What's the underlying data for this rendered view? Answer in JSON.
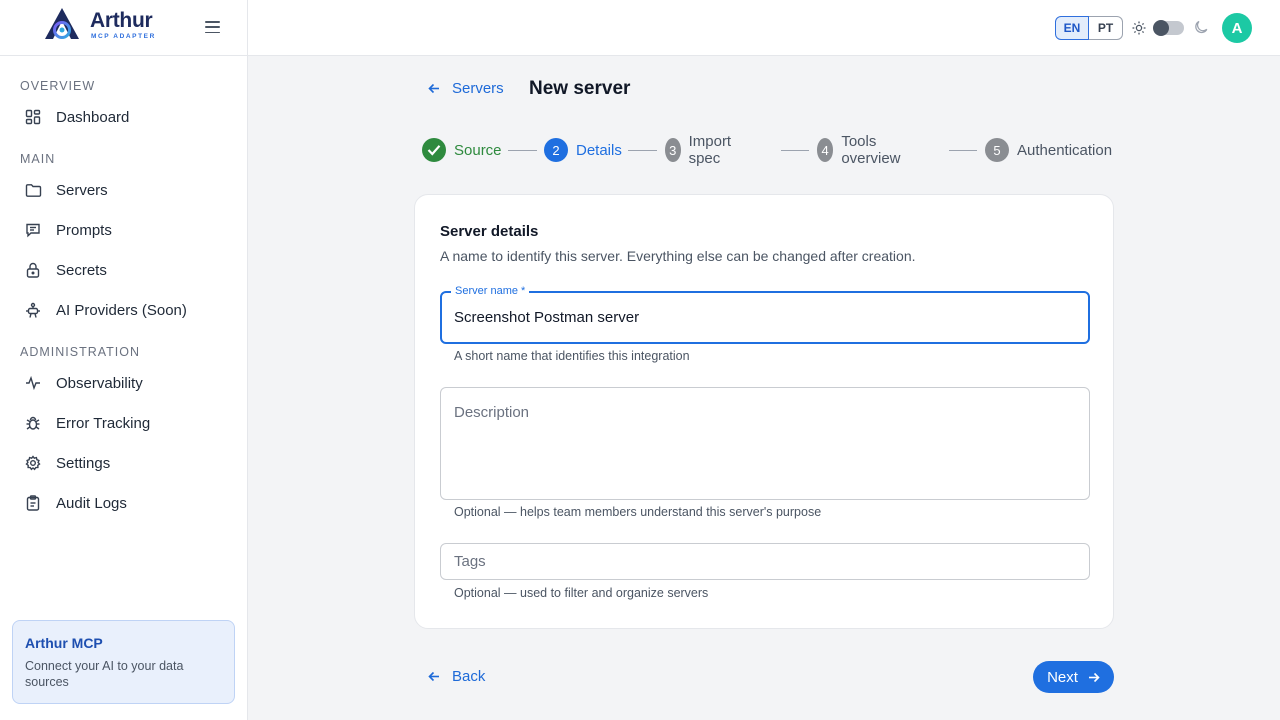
{
  "brand": {
    "name": "Arthur",
    "tagline": "MCP ADAPTER"
  },
  "sidebar": {
    "sections": [
      {
        "label": "OVERVIEW",
        "items": [
          {
            "label": "Dashboard",
            "icon": "dashboard-icon"
          }
        ]
      },
      {
        "label": "MAIN",
        "items": [
          {
            "label": "Servers",
            "icon": "folder-icon"
          },
          {
            "label": "Prompts",
            "icon": "message-icon"
          },
          {
            "label": "Secrets",
            "icon": "lock-icon"
          },
          {
            "label": "AI Providers (Soon)",
            "icon": "bot-icon"
          }
        ]
      },
      {
        "label": "ADMINISTRATION",
        "items": [
          {
            "label": "Observability",
            "icon": "activity-icon"
          },
          {
            "label": "Error Tracking",
            "icon": "bug-icon"
          },
          {
            "label": "Settings",
            "icon": "gear-icon"
          },
          {
            "label": "Audit Logs",
            "icon": "clipboard-icon"
          }
        ]
      }
    ],
    "promo": {
      "title": "Arthur MCP",
      "text": "Connect your AI to your data sources"
    }
  },
  "header": {
    "languages": [
      "EN",
      "PT"
    ],
    "active_language": "EN",
    "theme": "light",
    "avatar_initial": "A"
  },
  "page": {
    "back_label": "Servers",
    "title": "New server",
    "steps": [
      {
        "number": "1",
        "label": "Source",
        "state": "done"
      },
      {
        "number": "2",
        "label": "Details",
        "state": "current"
      },
      {
        "number": "3",
        "label": "Import spec",
        "state": "todo"
      },
      {
        "number": "4",
        "label": "Tools overview",
        "state": "todo"
      },
      {
        "number": "5",
        "label": "Authentication",
        "state": "todo"
      }
    ],
    "card": {
      "title": "Server details",
      "subtitle": "A name to identify this server. Everything else can be changed after creation.",
      "server_name": {
        "label": "Server name *",
        "value": "Screenshot Postman server",
        "helper": "A short name that identifies this integration"
      },
      "description": {
        "placeholder": "Description",
        "value": "",
        "helper": "Optional — helps team members understand this server's purpose"
      },
      "tags": {
        "placeholder": "Tags",
        "value": "",
        "helper": "Optional — used to filter and organize servers"
      }
    },
    "back_button": "Back",
    "next_button": "Next"
  },
  "colors": {
    "primary": "#1f6fe0",
    "success": "#2e8a3e",
    "avatar": "#1cc9a4",
    "brand_dark": "#1e2b5e"
  }
}
